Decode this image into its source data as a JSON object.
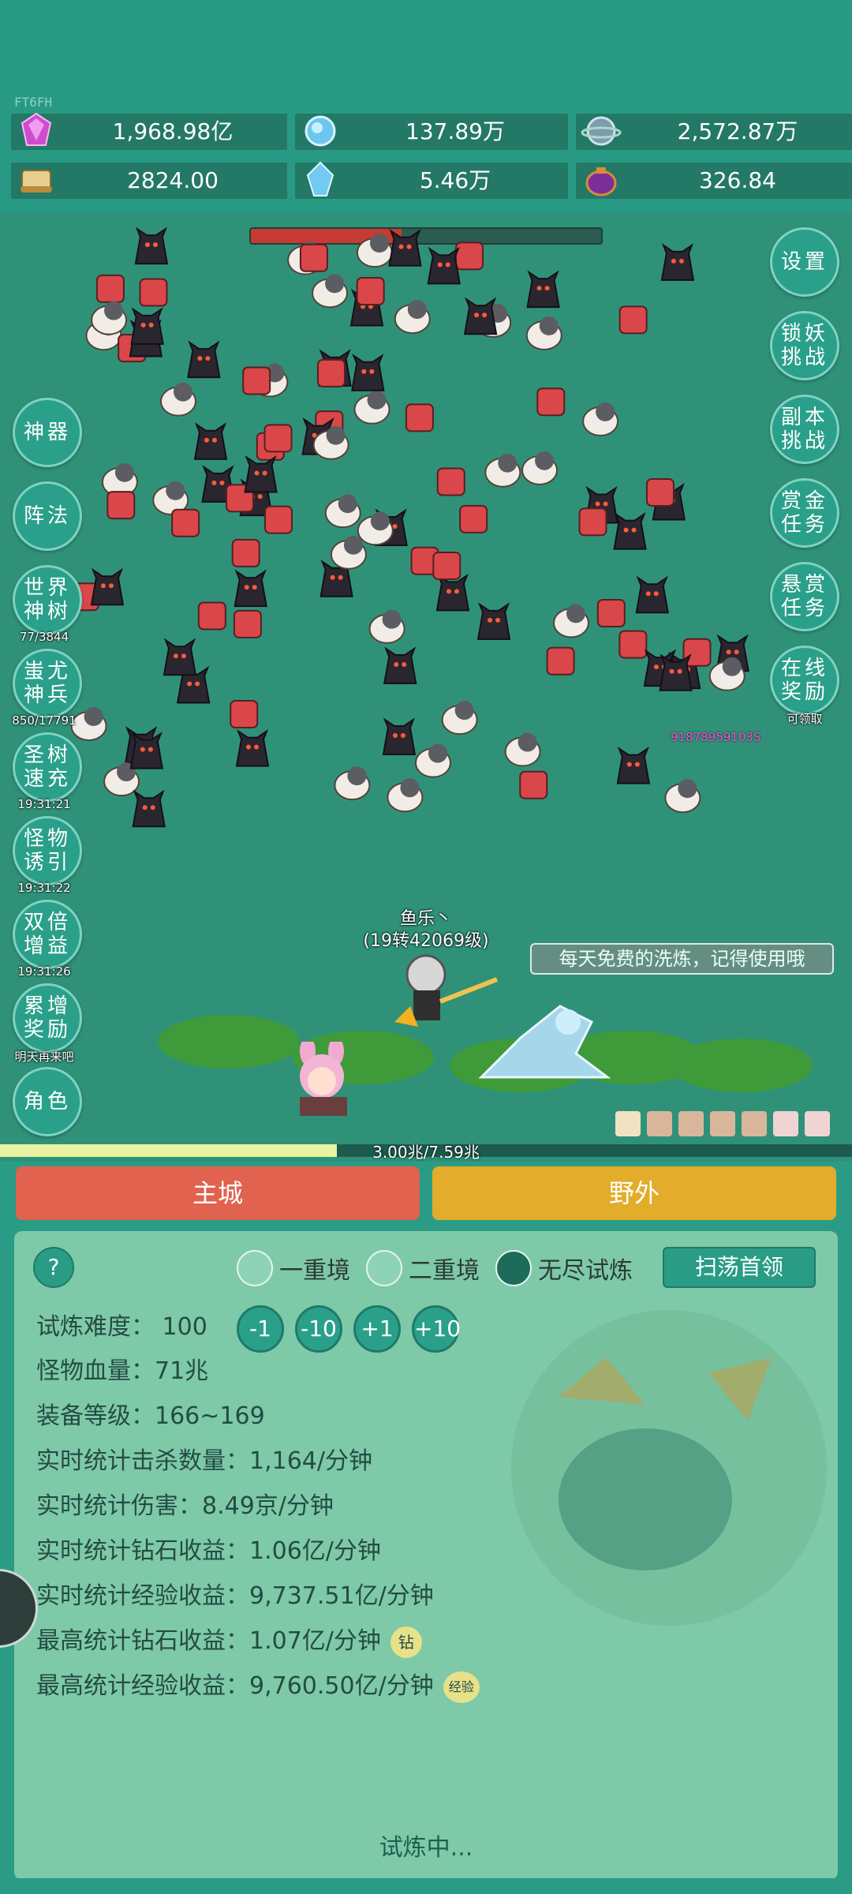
{
  "app": {
    "tag": "FT6FH"
  },
  "resources": [
    {
      "icon": "gem-icon",
      "value": "1,968.98亿"
    },
    {
      "icon": "crystal-orb-icon",
      "value": "137.89万"
    },
    {
      "icon": "planet-orb-icon",
      "value": "2,572.87万"
    },
    {
      "icon": "scroll-icon",
      "value": "2824.00"
    },
    {
      "icon": "ice-crystal-icon",
      "value": "5.46万"
    },
    {
      "icon": "purple-pouch-icon",
      "value": "326.84"
    }
  ],
  "boss_hp_fraction": 0.43,
  "left_buttons": [
    {
      "id": "artifact",
      "label": "神器",
      "sub": ""
    },
    {
      "id": "formation",
      "label": "阵法",
      "sub": ""
    },
    {
      "id": "world-tree",
      "label": "世界神树",
      "sub": "77/3844"
    },
    {
      "id": "chiyou",
      "label": "蚩尤神兵",
      "sub": "850/17791"
    },
    {
      "id": "tree-speed",
      "label": "圣树速充",
      "sub": "19:31:21"
    },
    {
      "id": "monster-lure",
      "label": "怪物诱引",
      "sub": "19:31:22"
    },
    {
      "id": "double-gain",
      "label": "双倍增益",
      "sub": "19:31:26"
    },
    {
      "id": "cumulative-reward",
      "label": "累增奖励",
      "sub": "明天再来吧"
    },
    {
      "id": "character",
      "label": "角色",
      "sub": ""
    }
  ],
  "right_buttons": [
    {
      "id": "settings",
      "label": "设置",
      "sub": ""
    },
    {
      "id": "lock-demon",
      "label": "锁妖挑战",
      "sub": ""
    },
    {
      "id": "dungeon",
      "label": "副本挑战",
      "sub": ""
    },
    {
      "id": "gold-task",
      "label": "赏金任务",
      "sub": ""
    },
    {
      "id": "bounty-task",
      "label": "悬赏任务",
      "sub": ""
    },
    {
      "id": "online-reward",
      "label": "在线奖励",
      "sub": "可领取"
    }
  ],
  "battle": {
    "player_name": "鱼乐丶",
    "player_level": "(19转42069级)",
    "damage_number": "91878959103S",
    "tip": "每天免费的洗炼，记得使用哦"
  },
  "progress": {
    "text": "3.00兆/7.59兆",
    "fraction": 0.395
  },
  "tabs": {
    "city": "主城",
    "field": "野外"
  },
  "trial": {
    "help": "?",
    "modes": [
      {
        "label": "一重境",
        "selected": false
      },
      {
        "label": "二重境",
        "selected": false
      },
      {
        "label": "无尽试炼",
        "selected": true
      }
    ],
    "sweep": "扫荡首领",
    "difficulty_label": "试炼难度：",
    "difficulty_value": "100",
    "adjust": [
      "-1",
      "-10",
      "+1",
      "+10"
    ],
    "stats": [
      {
        "label": "怪物血量：",
        "value": "71兆",
        "badge": ""
      },
      {
        "label": "装备等级：",
        "value": "166~169",
        "badge": ""
      },
      {
        "label": "实时统计击杀数量：",
        "value": "1,164/分钟",
        "badge": ""
      },
      {
        "label": "实时统计伤害：",
        "value": "8.49京/分钟",
        "badge": ""
      },
      {
        "label": "实时统计钻石收益：",
        "value": "1.06亿/分钟",
        "badge": ""
      },
      {
        "label": "实时统计经验收益：",
        "value": "9,737.51亿/分钟",
        "badge": ""
      },
      {
        "label": "最高统计钻石收益：",
        "value": "1.07亿/分钟",
        "badge": "钻"
      },
      {
        "label": "最高统计经验收益：",
        "value": "9,760.50亿/分钟",
        "badge": "经验"
      }
    ],
    "status": "试炼中..."
  },
  "colors": {
    "accent": "#2a9c86",
    "city_tab": "#e0624f",
    "field_tab": "#e3ac2a",
    "boss_hp": "#c53a32"
  }
}
